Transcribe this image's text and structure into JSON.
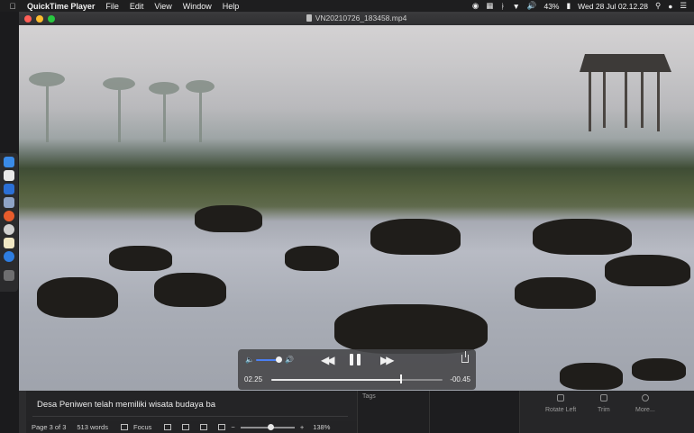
{
  "menubar": {
    "app_name": "QuickTime Player",
    "items": [
      "File",
      "Edit",
      "View",
      "Window",
      "Help"
    ],
    "status": {
      "battery": "43%",
      "datetime": "Wed 28 Jul  02.12.28"
    }
  },
  "window": {
    "title": "VN20210726_183458.mp4"
  },
  "player": {
    "current_time": "02.25",
    "remaining_time": "-00.45",
    "progress": 0.76,
    "volume": 0.6
  },
  "background_app": {
    "document_text": "Desa Peniwen telah memiliki wisata budaya ba",
    "page_info": "Page 3 of 3",
    "word_count": "513 words",
    "focus_label": "Focus",
    "zoom": "138%",
    "tags_label": "Tags",
    "tools": [
      "Rotate Left",
      "Trim",
      "More..."
    ]
  },
  "colors": {
    "accent_volume": "#4a7ff2",
    "traffic_close": "#ff5f57",
    "traffic_min": "#febc2e",
    "traffic_max": "#28c840"
  }
}
